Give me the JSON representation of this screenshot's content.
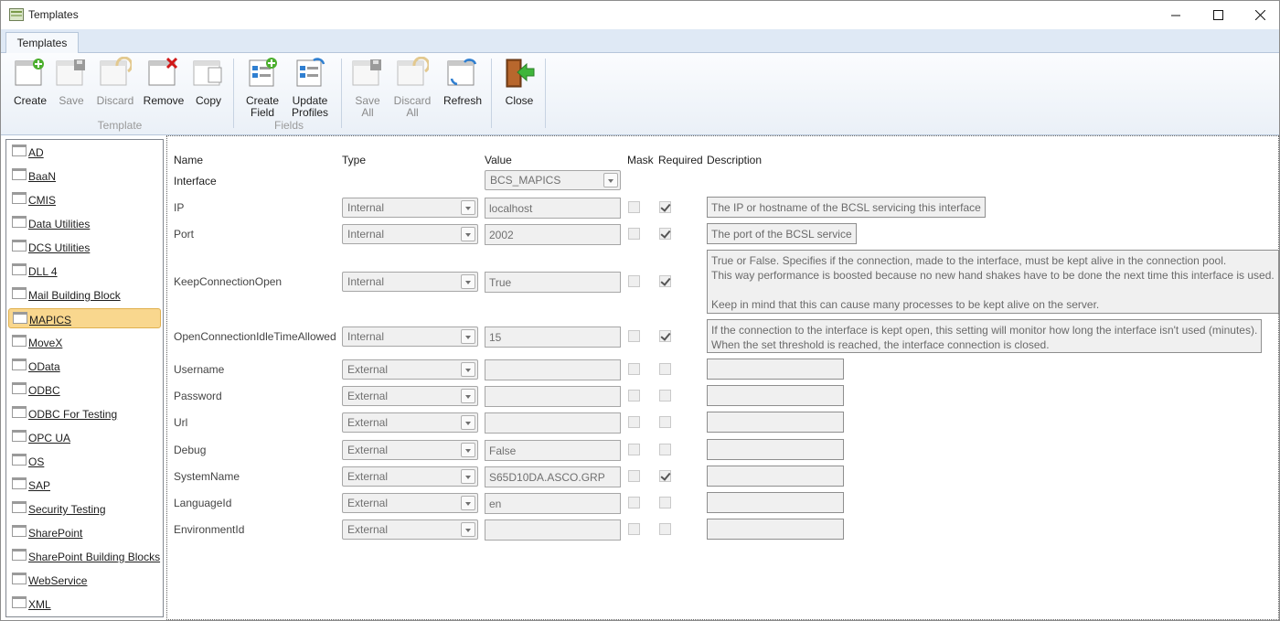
{
  "window": {
    "title": "Templates"
  },
  "tabs": [
    "Templates"
  ],
  "ribbon": {
    "template_group": {
      "label": "Template",
      "create": "Create",
      "save": "Save",
      "discard": "Discard",
      "remove": "Remove",
      "copy": "Copy"
    },
    "fields_group": {
      "label": "Fields",
      "create_field_1": "Create",
      "create_field_2": "Field",
      "update_profiles_1": "Update",
      "update_profiles_2": "Profiles"
    },
    "misc_group": {
      "save_all_1": "Save",
      "save_all_2": "All",
      "discard_all_1": "Discard",
      "discard_all_2": "All",
      "refresh": "Refresh"
    },
    "close_group": {
      "close": "Close"
    }
  },
  "templates": [
    "AD",
    "BaaN",
    "CMIS",
    "Data Utilities",
    "DCS Utilities",
    "DLL 4",
    "Mail Building Block",
    "MAPICS",
    "MoveX",
    "OData",
    "ODBC",
    "ODBC For Testing",
    "OPC UA",
    "OS",
    "SAP",
    "Security Testing",
    "SharePoint",
    "SharePoint Building Blocks",
    "WebService",
    "XML"
  ],
  "selected_template": "MAPICS",
  "grid": {
    "headers": {
      "name": "Name",
      "type": "Type",
      "value": "Value",
      "mask": "Mask",
      "required": "Required",
      "description": "Description"
    },
    "interface": {
      "label": "Interface",
      "value": "BCS_MAPICS"
    },
    "rows": [
      {
        "name": "IP",
        "type": "Internal",
        "value": "localhost",
        "mask": false,
        "required": true,
        "description": "The IP or hostname of the BCSL servicing this interface"
      },
      {
        "name": "Port",
        "type": "Internal",
        "value": "2002",
        "mask": false,
        "required": true,
        "description": "The port of the BCSL service"
      },
      {
        "name": "KeepConnectionOpen",
        "type": "Internal",
        "value": "True",
        "mask": false,
        "required": true,
        "description": "True or False. Specifies if the connection, made to the interface, must be kept alive in the connection pool.\nThis way performance is boosted because no new hand shakes have to be done the next time this interface is used.\n\nKeep in mind that this can cause many processes to be kept alive on the server."
      },
      {
        "name": "OpenConnectionIdleTimeAllowed",
        "type": "Internal",
        "value": "15",
        "mask": false,
        "required": true,
        "description": "If the connection to the interface is kept open, this setting will monitor how long the interface isn't used (minutes).\nWhen the set threshold is reached, the interface connection is closed."
      },
      {
        "name": "Username",
        "type": "External",
        "value": "",
        "mask": false,
        "required": false,
        "description": ""
      },
      {
        "name": "Password",
        "type": "External",
        "value": "",
        "mask": false,
        "required": false,
        "description": ""
      },
      {
        "name": "Url",
        "type": "External",
        "value": "",
        "mask": false,
        "required": false,
        "description": ""
      },
      {
        "name": "Debug",
        "type": "External",
        "value": "False",
        "mask": false,
        "required": false,
        "description": ""
      },
      {
        "name": "SystemName",
        "type": "External",
        "value": "S65D10DA.ASCO.GRP",
        "mask": false,
        "required": true,
        "description": ""
      },
      {
        "name": "LanguageId",
        "type": "External",
        "value": "en",
        "mask": false,
        "required": false,
        "description": ""
      },
      {
        "name": "EnvironmentId",
        "type": "External",
        "value": "",
        "mask": false,
        "required": false,
        "description": ""
      }
    ]
  }
}
